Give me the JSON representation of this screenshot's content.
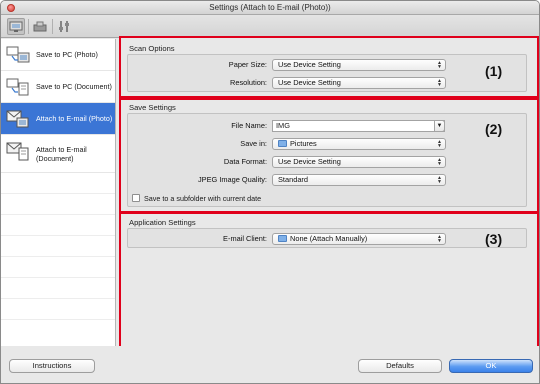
{
  "window": {
    "title": "Settings (Attach to E-mail (Photo))"
  },
  "toolbar": {
    "icons": [
      "scan-from-computer-icon",
      "scan-from-operation-panel-icon",
      "general-settings-icon"
    ]
  },
  "sidebar": {
    "items": [
      {
        "label": "Save to PC (Photo)",
        "icon": "save-photo-icon",
        "selected": false
      },
      {
        "label": "Save to PC (Document)",
        "icon": "save-document-icon",
        "selected": false
      },
      {
        "label": "Attach to E-mail (Photo)",
        "icon": "email-photo-icon",
        "selected": true
      },
      {
        "label": "Attach to E-mail (Document)",
        "icon": "email-document-icon",
        "selected": false
      }
    ]
  },
  "scan_options": {
    "title": "Scan Options",
    "paper_size_label": "Paper Size:",
    "paper_size_value": "Use Device Setting",
    "resolution_label": "Resolution:",
    "resolution_value": "Use Device Setting",
    "marker": "(1)"
  },
  "save_settings": {
    "title": "Save Settings",
    "file_name_label": "File Name:",
    "file_name_value": "IMG",
    "save_in_label": "Save in:",
    "save_in_value": "Pictures",
    "data_format_label": "Data Format:",
    "data_format_value": "Use Device Setting",
    "jpeg_quality_label": "JPEG Image Quality:",
    "jpeg_quality_value": "Standard",
    "subfolder_label": "Save to a subfolder with current date",
    "subfolder_checked": false,
    "marker": "(2)"
  },
  "application_settings": {
    "title": "Application Settings",
    "email_client_label": "E-mail Client:",
    "email_client_value": "None (Attach Manually)",
    "marker": "(3)"
  },
  "buttons": {
    "instructions": "Instructions",
    "defaults": "Defaults",
    "ok": "OK"
  },
  "colors": {
    "highlight": "#e0001b",
    "selection": "#3b75d5",
    "default_button": "#3b82ea"
  }
}
